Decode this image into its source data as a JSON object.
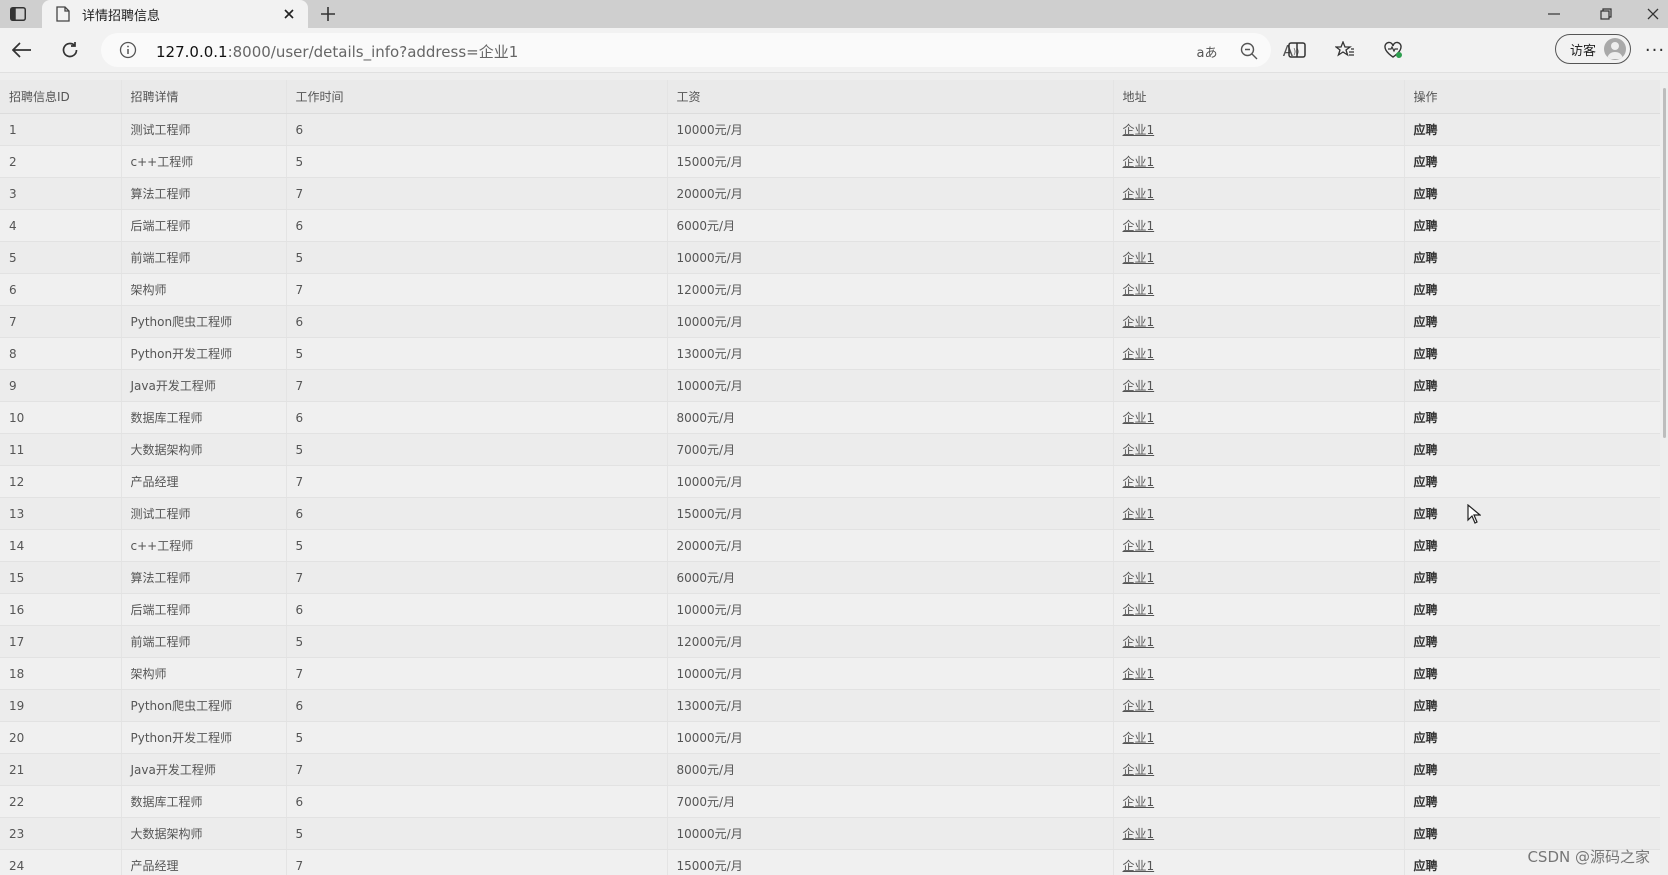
{
  "browser": {
    "tab_title": "详情招聘信息",
    "url_host": "127.0.0.1",
    "url_rest": ":8000/user/details_info?address=企业1",
    "profile_label": "访客",
    "more_label": "···",
    "addr_translate_label": "aあ",
    "addr_read_label": "A"
  },
  "table": {
    "headers": [
      "招聘信息ID",
      "招聘详情",
      "工作时间",
      "工资",
      "地址",
      "操作"
    ],
    "rows": [
      [
        "1",
        "测试工程师",
        "6",
        "10000元/月",
        "企业1",
        "应聘"
      ],
      [
        "2",
        "c++工程师",
        "5",
        "15000元/月",
        "企业1",
        "应聘"
      ],
      [
        "3",
        "算法工程师",
        "7",
        "20000元/月",
        "企业1",
        "应聘"
      ],
      [
        "4",
        "后端工程师",
        "6",
        "6000元/月",
        "企业1",
        "应聘"
      ],
      [
        "5",
        "前端工程师",
        "5",
        "10000元/月",
        "企业1",
        "应聘"
      ],
      [
        "6",
        "架构师",
        "7",
        "12000元/月",
        "企业1",
        "应聘"
      ],
      [
        "7",
        "Python爬虫工程师",
        "6",
        "10000元/月",
        "企业1",
        "应聘"
      ],
      [
        "8",
        "Python开发工程师",
        "5",
        "13000元/月",
        "企业1",
        "应聘"
      ],
      [
        "9",
        "Java开发工程师",
        "7",
        "10000元/月",
        "企业1",
        "应聘"
      ],
      [
        "10",
        "数据库工程师",
        "6",
        "8000元/月",
        "企业1",
        "应聘"
      ],
      [
        "11",
        "大数据架构师",
        "5",
        "7000元/月",
        "企业1",
        "应聘"
      ],
      [
        "12",
        "产品经理",
        "7",
        "10000元/月",
        "企业1",
        "应聘"
      ],
      [
        "13",
        "测试工程师",
        "6",
        "15000元/月",
        "企业1",
        "应聘"
      ],
      [
        "14",
        "c++工程师",
        "5",
        "20000元/月",
        "企业1",
        "应聘"
      ],
      [
        "15",
        "算法工程师",
        "7",
        "6000元/月",
        "企业1",
        "应聘"
      ],
      [
        "16",
        "后端工程师",
        "6",
        "10000元/月",
        "企业1",
        "应聘"
      ],
      [
        "17",
        "前端工程师",
        "5",
        "12000元/月",
        "企业1",
        "应聘"
      ],
      [
        "18",
        "架构师",
        "7",
        "10000元/月",
        "企业1",
        "应聘"
      ],
      [
        "19",
        "Python爬虫工程师",
        "6",
        "13000元/月",
        "企业1",
        "应聘"
      ],
      [
        "20",
        "Python开发工程师",
        "5",
        "10000元/月",
        "企业1",
        "应聘"
      ],
      [
        "21",
        "Java开发工程师",
        "7",
        "8000元/月",
        "企业1",
        "应聘"
      ],
      [
        "22",
        "数据库工程师",
        "6",
        "7000元/月",
        "企业1",
        "应聘"
      ],
      [
        "23",
        "大数据架构师",
        "5",
        "10000元/月",
        "企业1",
        "应聘"
      ],
      [
        "24",
        "产品经理",
        "7",
        "15000元/月",
        "企业1",
        "应聘"
      ]
    ]
  },
  "watermark": "CSDN @源码之家"
}
